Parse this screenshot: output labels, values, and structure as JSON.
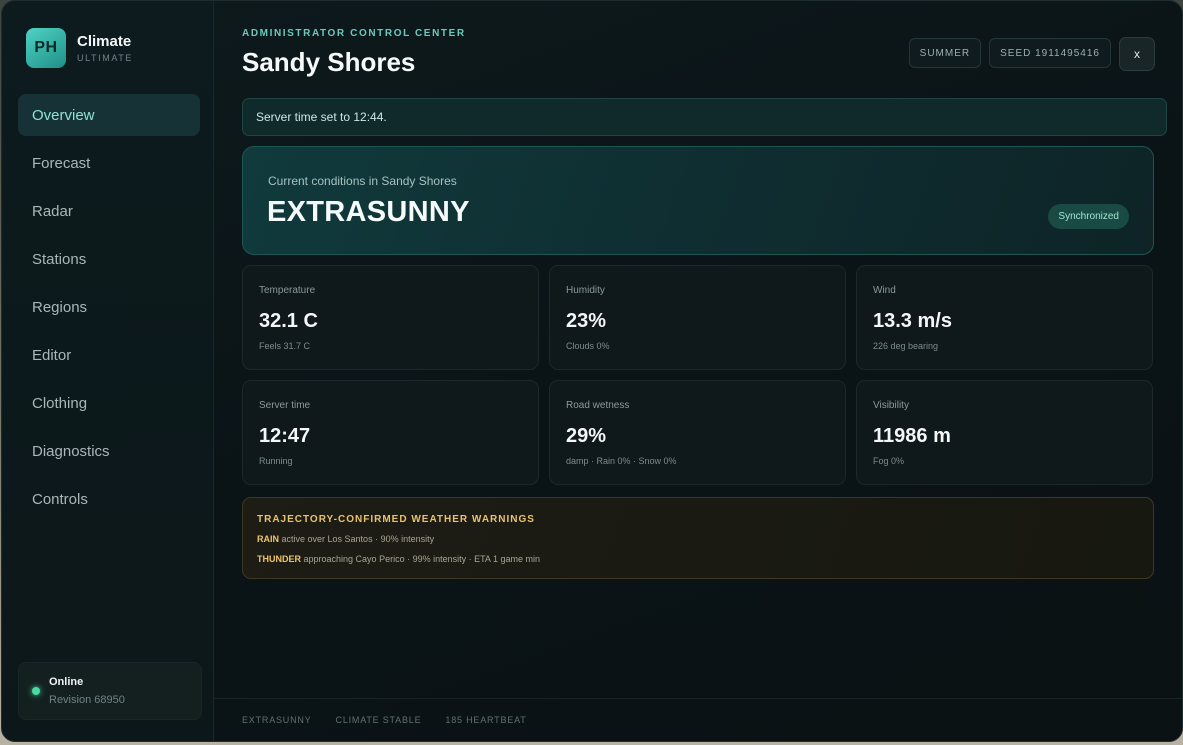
{
  "brand": {
    "logo_text": "PH",
    "name": "Climate",
    "subtitle": "ULTIMATE"
  },
  "sidebar": {
    "items": [
      {
        "label": "Overview",
        "active": true
      },
      {
        "label": "Forecast",
        "active": false
      },
      {
        "label": "Radar",
        "active": false
      },
      {
        "label": "Stations",
        "active": false
      },
      {
        "label": "Regions",
        "active": false
      },
      {
        "label": "Editor",
        "active": false
      },
      {
        "label": "Clothing",
        "active": false
      },
      {
        "label": "Diagnostics",
        "active": false
      },
      {
        "label": "Controls",
        "active": false
      }
    ],
    "status": {
      "title": "Online",
      "revision": "Revision 68950",
      "color": "#49d9a3"
    }
  },
  "header": {
    "eyebrow": "ADMINISTRATOR CONTROL CENTER",
    "title": "Sandy Shores",
    "season_chip": "SUMMER",
    "seed_chip": "SEED 1911495416",
    "close_label": "x"
  },
  "notice": {
    "text": "Server time set to 12:44."
  },
  "hero": {
    "label": "Current conditions in Sandy Shores",
    "value": "EXTRASUNNY",
    "badge": "Synchronized"
  },
  "stats": [
    {
      "label": "Temperature",
      "value": "32.1 C",
      "sub": "Feels 31.7 C"
    },
    {
      "label": "Humidity",
      "value": "23%",
      "sub": "Clouds 0%"
    },
    {
      "label": "Wind",
      "value": "13.3 m/s",
      "sub": "226 deg bearing"
    },
    {
      "label": "Server time",
      "value": "12:47",
      "sub": "Running"
    },
    {
      "label": "Road wetness",
      "value": "29%",
      "sub": "damp · Rain 0% · Snow 0%"
    },
    {
      "label": "Visibility",
      "value": "11986 m",
      "sub": "Fog 0%"
    }
  ],
  "warnings": {
    "title": "TRAJECTORY-CONFIRMED WEATHER WARNINGS",
    "items": [
      {
        "type": "RAIN",
        "text": "active over Los Santos · 90% intensity"
      },
      {
        "type": "THUNDER",
        "text": "approaching Cayo Perico · 99% intensity · ETA 1 game min"
      }
    ]
  },
  "footer": {
    "items": [
      "EXTRASUNNY",
      "CLIMATE STABLE",
      "185 HEARTBEAT"
    ]
  },
  "colors": {
    "accent": "#6ac9bc",
    "warning": "#e9c36d",
    "online": "#49d9a3"
  }
}
